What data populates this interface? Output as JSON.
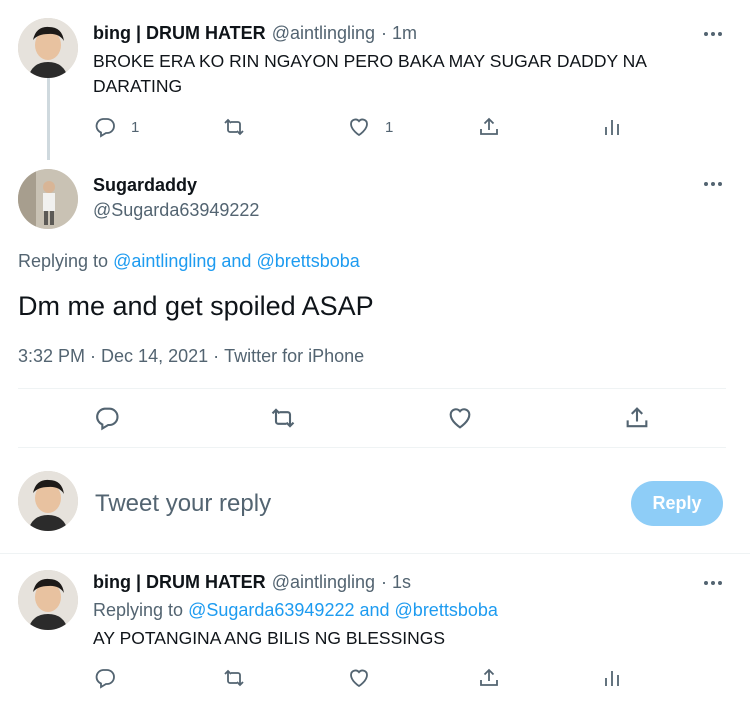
{
  "tweet1": {
    "name": "bing | DRUM HATER",
    "handle": "@aintlingling",
    "time": "· 1m",
    "text": "BROKE ERA KO RIN NGAYON PERO BAKA MAY SUGAR DADDY NA DARATING",
    "replies": "1",
    "likes": "1"
  },
  "focus": {
    "name": "Sugardaddy",
    "handle": "@Sugarda63949222",
    "replying_prefix": "Replying to",
    "replying_user1": "@aintlingling",
    "replying_and": "and",
    "replying_user2": "@brettsboba",
    "text": "Dm me and get spoiled ASAP",
    "time": "3:32 PM",
    "sep": "·",
    "date": "Dec 14, 2021",
    "source": "Twitter for iPhone"
  },
  "composer": {
    "placeholder": "Tweet your reply",
    "button": "Reply"
  },
  "tweet2": {
    "name": "bing | DRUM HATER",
    "handle": "@aintlingling",
    "time": "· 1s",
    "replying_prefix": "Replying to",
    "replying_user1": "@Sugarda63949222",
    "replying_and": "and",
    "replying_user2": "@brettsboba",
    "text": "AY POTANGINA ANG BILIS NG BLESSINGS"
  },
  "icons": {
    "reply": "reply-icon",
    "retweet": "retweet-icon",
    "like": "heart-icon",
    "share": "share-icon",
    "analytics": "analytics-icon",
    "more": "more-icon"
  },
  "colors": {
    "accent": "#1d9bf0",
    "reply_button": "#8ecdf7",
    "secondary_text": "#536471",
    "divider": "#eff3f4"
  }
}
